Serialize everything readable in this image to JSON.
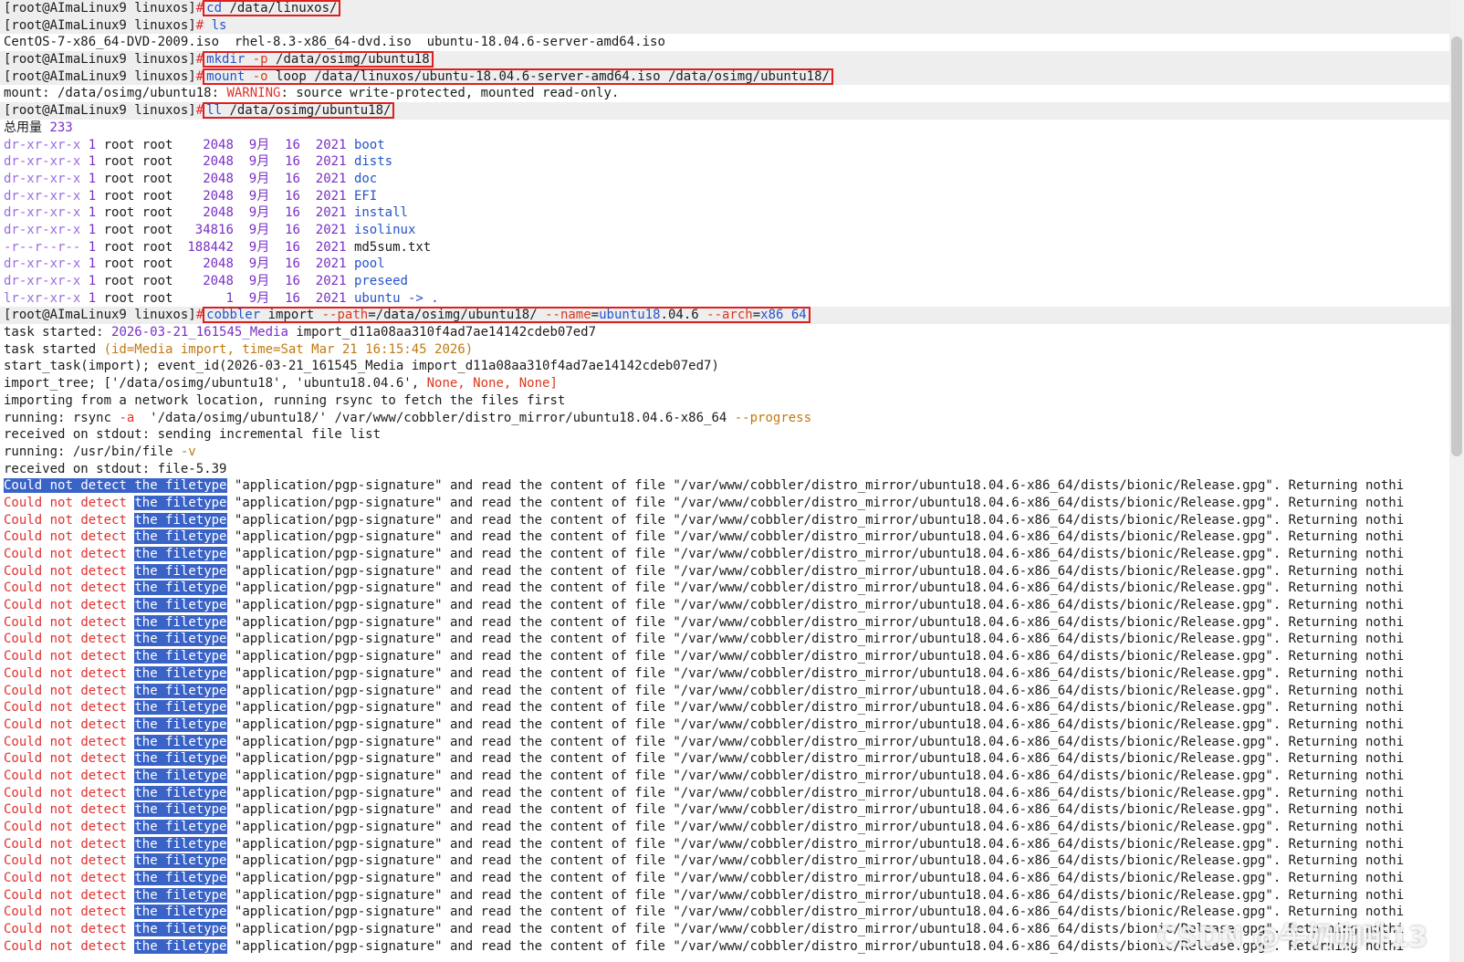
{
  "prompt": "[root@AImaLinux9 linuxos]",
  "pipe": "#",
  "commands": {
    "cd": {
      "cmd": "cd",
      "arg": "/data/linuxos/"
    },
    "ls": {
      "cmd": "ls"
    },
    "ls_output": "CentOS-7-x86_64-DVD-2009.iso  rhel-8.3-x86_64-dvd.iso  ubuntu-18.04.6-server-amd64.iso",
    "mkdir": {
      "cmd": "mkdir",
      "flag": "-p",
      "arg": "/data/osimg/ubuntu18"
    },
    "mount": {
      "cmd": "mount",
      "flag": "-o",
      "opt": "loop",
      "src": "/data/linuxos/ubuntu-18.04.6-server-amd64.iso",
      "dst": "/data/osimg/ubuntu18/"
    },
    "mount_output": {
      "prefix": "mount: /data/osimg/ubuntu18: ",
      "warn": "WARNING",
      "rest": ": source write-protected, mounted read-only."
    },
    "ll": {
      "cmd": "ll",
      "arg": "/data/osimg/ubuntu18/"
    },
    "total": {
      "label": "总用量",
      "value": "233"
    },
    "listing": [
      {
        "perm": "dr-xr-xr-x",
        "links": "1",
        "owner": "root",
        "group": "root",
        "size": "2048",
        "month": "9月",
        "day": "16",
        "year": "2021",
        "name": "boot",
        "dir": true
      },
      {
        "perm": "dr-xr-xr-x",
        "links": "1",
        "owner": "root",
        "group": "root",
        "size": "2048",
        "month": "9月",
        "day": "16",
        "year": "2021",
        "name": "dists",
        "dir": true
      },
      {
        "perm": "dr-xr-xr-x",
        "links": "1",
        "owner": "root",
        "group": "root",
        "size": "2048",
        "month": "9月",
        "day": "16",
        "year": "2021",
        "name": "doc",
        "dir": true
      },
      {
        "perm": "dr-xr-xr-x",
        "links": "1",
        "owner": "root",
        "group": "root",
        "size": "2048",
        "month": "9月",
        "day": "16",
        "year": "2021",
        "name": "EFI",
        "dir": true
      },
      {
        "perm": "dr-xr-xr-x",
        "links": "1",
        "owner": "root",
        "group": "root",
        "size": "2048",
        "month": "9月",
        "day": "16",
        "year": "2021",
        "name": "install",
        "dir": true
      },
      {
        "perm": "dr-xr-xr-x",
        "links": "1",
        "owner": "root",
        "group": "root",
        "size": "34816",
        "month": "9月",
        "day": "16",
        "year": "2021",
        "name": "isolinux",
        "dir": true
      },
      {
        "perm": "-r--r--r--",
        "links": "1",
        "owner": "root",
        "group": "root",
        "size": "188442",
        "month": "9月",
        "day": "16",
        "year": "2021",
        "name": "md5sum.txt",
        "dir": false
      },
      {
        "perm": "dr-xr-xr-x",
        "links": "1",
        "owner": "root",
        "group": "root",
        "size": "2048",
        "month": "9月",
        "day": "16",
        "year": "2021",
        "name": "pool",
        "dir": true
      },
      {
        "perm": "dr-xr-xr-x",
        "links": "1",
        "owner": "root",
        "group": "root",
        "size": "2048",
        "month": "9月",
        "day": "16",
        "year": "2021",
        "name": "preseed",
        "dir": true
      },
      {
        "perm": "lr-xr-xr-x",
        "links": "1",
        "owner": "root",
        "group": "root",
        "size": "1",
        "month": "9月",
        "day": "16",
        "year": "2021",
        "name": "ubuntu -> .",
        "dir": true
      }
    ],
    "cobbler": {
      "cmd": "cobbler",
      "sub": "import",
      "p1": "--path",
      "v1": "/data/osimg/ubuntu18/",
      "p2": "--name",
      "v2": "ubuntu18",
      "v2b": ".04.6",
      "p3": "--arch",
      "v3": "x86_64"
    }
  },
  "log": [
    {
      "a": "task started: ",
      "b": "2026-03-21_161545_Media",
      "c": " import_d11a08aa310f4ad7ae14142cdeb07ed7"
    },
    {
      "a": "task started ",
      "b": "(id=Media import, time=Sat Mar 21 16:15:45 2026)"
    },
    {
      "a": "start_task(import); event_id(2026-03-21_161545_Media import_d11a08aa310f4ad7ae14142cdeb07ed7)"
    },
    {
      "a": "import_tree; ['/data/osimg/ubuntu18', 'ubuntu18.04.6', ",
      "b": "None, None, None]"
    },
    {
      "a": "importing from a network location, running rsync to fetch the files first"
    },
    {
      "a": "running: rsync ",
      "b": "-a",
      "c": "  '/data/osimg/ubuntu18/' /var/www/cobbler/distro_mirror/ubuntu18.04.6-x86_64 ",
      "d": "--progress"
    },
    {
      "a": "received on stdout: sending incremental file list"
    },
    {
      "a": "running: /usr/bin/file ",
      "b": "-v"
    },
    {
      "a": "received on stdout: file-5.39"
    }
  ],
  "error_line": {
    "w1": "Could",
    "w2": "not",
    "w3": "detect",
    "w4": "the filetype",
    "mime": " \"application/pgp-signature\" ",
    "mid": "and read the content of file ",
    "path": "\"/var/www/cobbler/distro_mirror/ubuntu18.04.6-x86_64/dists/bionic/Release.gpg\"",
    "tail": ". Returning nothi"
  },
  "error_repeat_count": 28,
  "watermark": "CSDN @牛奶咖啡13",
  "colors": {
    "highlight_box": "#e01e1e",
    "selection": "#3a63c8",
    "command": "#2553c9",
    "flag": "#d9381e",
    "permission": "#9b6be0",
    "number": "#7a2fc5"
  }
}
